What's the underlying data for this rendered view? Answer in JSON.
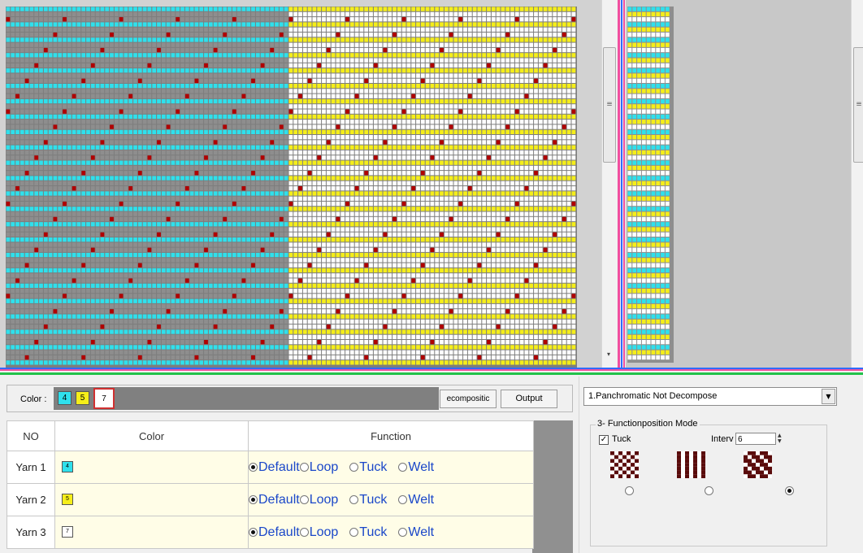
{
  "pattern": {
    "colors": {
      "cyan": "#2fe0ec",
      "gray": "#8e8e8e",
      "dot": "#b00000",
      "yellow": "#f5ee1a",
      "white": "#ffffff",
      "pink": "#f04fa0",
      "blue": "#2f6cff",
      "green": "#22c24a"
    }
  },
  "color_bar": {
    "label": "Color :",
    "chips": [
      {
        "label": "4",
        "bg": "#2fe0ec"
      },
      {
        "label": "5",
        "bg": "#f5ee1a"
      },
      {
        "label": "7",
        "bg": "#ffffff",
        "border": "#d03030"
      }
    ],
    "decompose_label": "ecompositic",
    "output_label": "Output"
  },
  "yarn_table": {
    "headers": {
      "no": "NO",
      "color": "Color",
      "function": "Function"
    },
    "options": [
      "Default",
      "Loop",
      "Tuck",
      "Welt"
    ],
    "rows": [
      {
        "no": "Yarn 1",
        "chip": "4",
        "chip_bg": "#2fe0ec",
        "selected": "Default"
      },
      {
        "no": "Yarn 2",
        "chip": "5",
        "chip_bg": "#f5ee1a",
        "selected": "Default"
      },
      {
        "no": "Yarn 3",
        "chip": "7",
        "chip_bg": "#ffffff",
        "selected": "Default"
      }
    ]
  },
  "mode_select": {
    "value": "1.Panchromatic Not Decompose"
  },
  "function_group": {
    "title": "3- Functionposition Mode",
    "tuck_label": "Tuck",
    "tuck_checked": true,
    "interval_label": "Interv",
    "interval_value": "6",
    "selected_thumbnail": 3
  }
}
